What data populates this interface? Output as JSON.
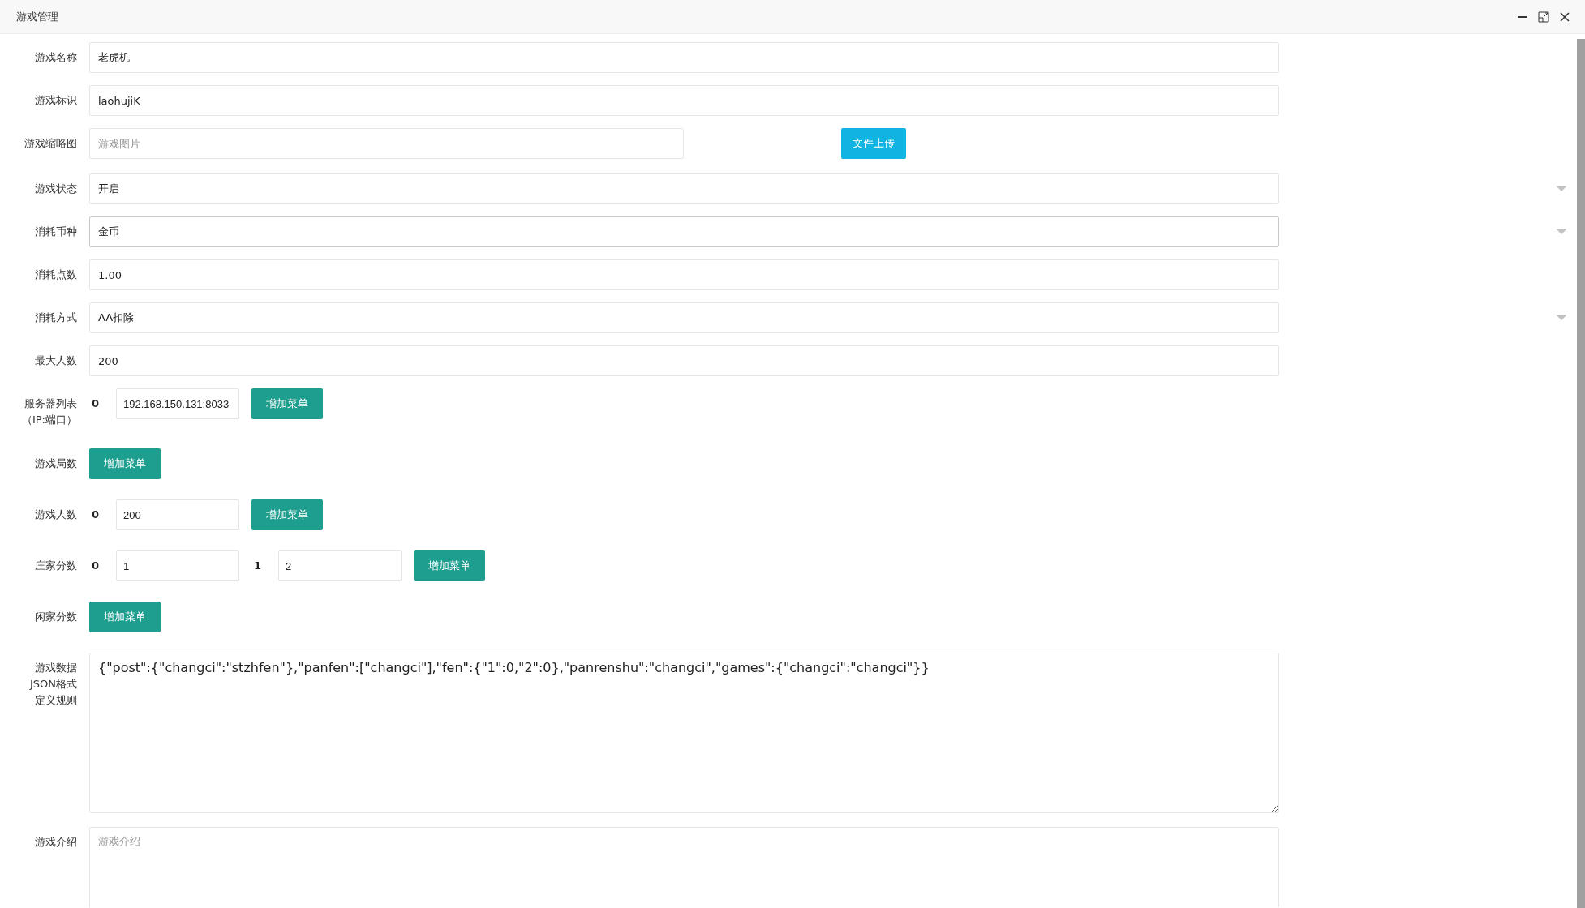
{
  "window": {
    "title": "游戏管理"
  },
  "fields": [
    {
      "kind": "text",
      "label": "游戏名称",
      "value": "老虎机"
    },
    {
      "kind": "text",
      "label": "游戏标识",
      "value": "laohujiK"
    },
    {
      "kind": "image",
      "label": "游戏缩略图",
      "placeholder": "游戏图片",
      "button": "文件上传"
    },
    {
      "kind": "select",
      "label": "游戏状态",
      "value": "开启",
      "focused": false
    },
    {
      "kind": "select",
      "label": "消耗币种",
      "value": "金币",
      "focused": true
    },
    {
      "kind": "text",
      "label": "消耗点数",
      "value": "1.00"
    },
    {
      "kind": "select",
      "label": "消耗方式",
      "value": "AA扣除",
      "focused": false
    },
    {
      "kind": "text",
      "label": "最大人数",
      "value": "200"
    },
    {
      "kind": "list",
      "label": [
        "服务器列表",
        "（IP:端口）"
      ],
      "items": [
        {
          "index": "0",
          "value": "192.168.150.131:8033"
        }
      ],
      "button": "增加菜单"
    },
    {
      "kind": "list",
      "label": "游戏局数",
      "button": "增加菜单"
    },
    {
      "kind": "list",
      "label": "游戏人数",
      "items": [
        {
          "index": "0",
          "value": "200"
        }
      ],
      "button": "增加菜单"
    },
    {
      "kind": "list",
      "label": "庄家分数",
      "items": [
        {
          "index": "0",
          "value": "1"
        },
        {
          "index": "1",
          "value": "2"
        }
      ],
      "button": "增加菜单"
    },
    {
      "kind": "list",
      "label": "闲家分数",
      "button": "增加菜单"
    },
    {
      "kind": "textarea",
      "label": [
        "游戏数据",
        "JSON格式",
        "定义规则"
      ],
      "value": "{\"post\":{\"changci\":\"stzhfen\"},\"panfen\":[\"changci\"],\"fen\":{\"1\":0,\"2\":0},\"panrenshu\":\"changci\",\"games\":{\"changci\":\"changci\"}}"
    },
    {
      "kind": "textarea",
      "label": "游戏介绍",
      "placeholder": "游戏介绍"
    }
  ]
}
